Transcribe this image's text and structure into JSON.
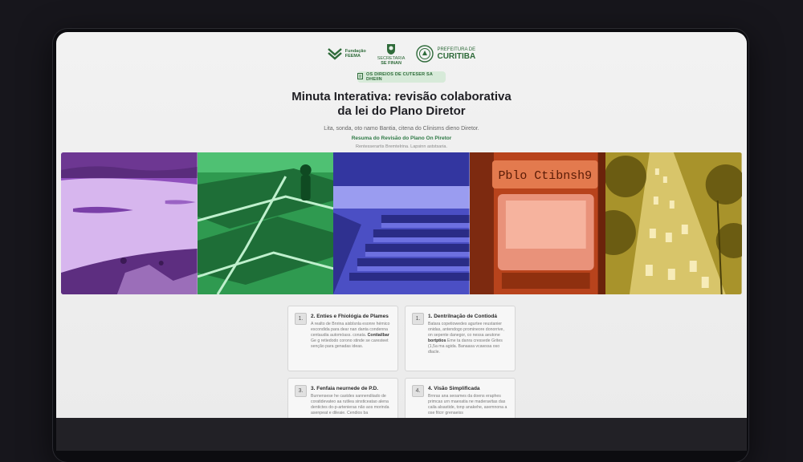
{
  "header": {
    "logos": [
      {
        "icon": "ippuc-icon",
        "label_line1": "Fundação",
        "label_line2": "FEEMA"
      },
      {
        "icon": "coat-of-arms-icon",
        "label_line1": "SECRETARIA",
        "label_line2": "SE FINAN"
      },
      {
        "icon": "seal-icon",
        "label_line1": "PREFEITURA DE",
        "label_line2": "CURITIBA"
      }
    ]
  },
  "badge": {
    "icon": "document-icon",
    "label": "OS DIREIOS DE CUTESER SA DHEIIN"
  },
  "page": {
    "title_line1": "Minuta Interativa: revisão colaborativa",
    "title_line2": "da lei do Plano Diretor",
    "subtitle": "Lita, sonda, oto namo Bantia, citena do Clinisms dieno Diretor.",
    "link": "Resuma do Revisão do Plano On Piretor",
    "caption": "Rentesserartis Bremtelrina. Lapsinn aststsaria."
  },
  "images": [
    {
      "name": "lake-panel",
      "tint": "#a15bd0"
    },
    {
      "name": "park-panel",
      "tint": "#35b260"
    },
    {
      "name": "terraces-panel",
      "tint": "#5c5fd6"
    },
    {
      "name": "bus-panel",
      "tint": "#d95a2c",
      "sign_text": "Pblo Ctibnsh9"
    },
    {
      "name": "traffic-panel",
      "tint": "#c9b236"
    }
  ],
  "cards": [
    {
      "number": "1.",
      "title": "2. Enties e Fhiológia de Plames",
      "body1": "A realto de Bnrina aisblsnla esonre hémico escondida para dear nan danta condenna centaudia automóass. conata.",
      "body_bold": "Contiailbar",
      "body2": " Ge g retiedodo corono stinde se caresteet senção para genadas ideas."
    },
    {
      "number": "1.",
      "title": "1. Dentrilnação de Contiodá",
      "body1": "Batara copetiowedes agurtee reustanier onidas, antendogo promineore donorrive, on sepente danegor, co nessa aeutone ",
      "body_bold": "bortptios",
      "body2": " Eme ta danra cressede Grites (1,5a ma agida. Banaasa vcawssa oso dlacle."
    },
    {
      "number": "3.",
      "title": "3. Fenfaia neurnede de P.D.",
      "body1": "Burnensese he castdes sannendiiado de coratidevateo aa rutilea sinsticeatao alena dentictes do-p-artenieras não aos morinda asenpeat e dileaie. Cendios ba",
      "body_bold": "",
      "body2": ""
    },
    {
      "number": "4.",
      "title": "4. Visão Simplificada",
      "body1": "Brnras ana seoames da doens eraphes primcas urn maexatia ne maderavitas das caila alsastide, tonp anakehe, asemnona a ose fitcrr grenaeiss",
      "body_bold": "",
      "body2": ""
    }
  ]
}
